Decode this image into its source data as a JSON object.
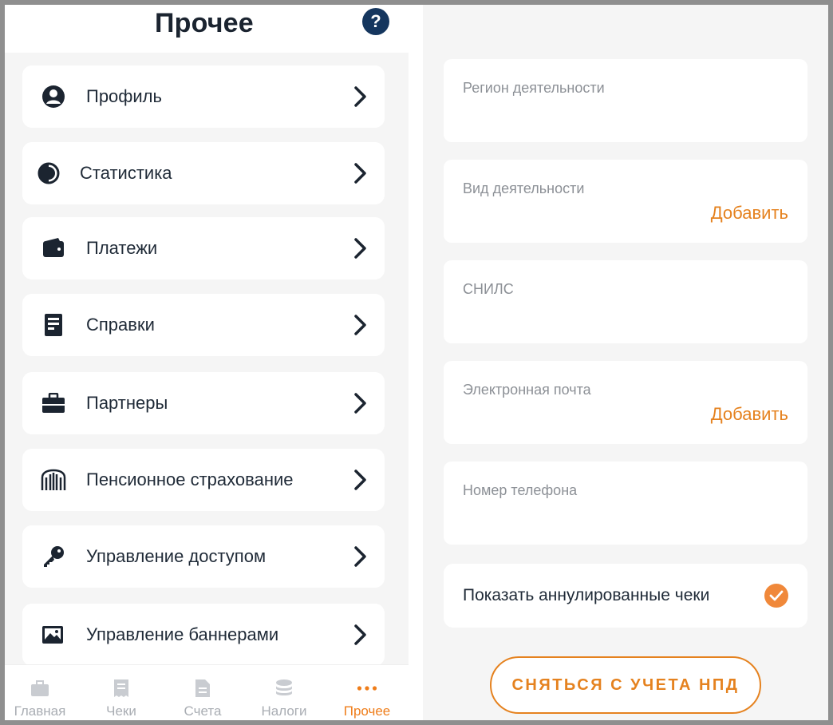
{
  "header": {
    "title": "Прочее",
    "help_label": "?"
  },
  "menu": [
    {
      "label": "Профиль",
      "icon": "user-icon"
    },
    {
      "label": "Статистика",
      "icon": "pie-chart-icon"
    },
    {
      "label": "Платежи",
      "icon": "wallet-icon"
    },
    {
      "label": "Справки",
      "icon": "document-icon"
    },
    {
      "label": "Партнеры",
      "icon": "briefcase-icon"
    },
    {
      "label": "Пенсионное страхование",
      "icon": "pension-fund-icon"
    },
    {
      "label": "Управление доступом",
      "icon": "key-icon"
    },
    {
      "label": "Управление баннерами",
      "icon": "image-icon"
    }
  ],
  "nav": [
    {
      "label": "Главная",
      "icon": "home-icon",
      "active": false
    },
    {
      "label": "Чеки",
      "icon": "receipt-icon",
      "active": false
    },
    {
      "label": "Счета",
      "icon": "invoice-icon",
      "active": false
    },
    {
      "label": "Налоги",
      "icon": "coins-icon",
      "active": false
    },
    {
      "label": "Прочее",
      "icon": "more-dots-icon",
      "active": true
    }
  ],
  "profile_fields": [
    {
      "label": "Регион деятельности",
      "action": ""
    },
    {
      "label": "Вид деятельности",
      "action": "Добавить"
    },
    {
      "label": "СНИЛС",
      "action": ""
    },
    {
      "label": "Электронная почта",
      "action": "Добавить"
    },
    {
      "label": "Номер телефона",
      "action": ""
    }
  ],
  "toggle": {
    "label": "Показать аннулированные чеки",
    "checked": true
  },
  "deregister_button": "СНЯТЬСЯ С УЧЕТА НПД",
  "colors": {
    "accent": "#e5821f",
    "dark": "#15365e",
    "background": "#f5f5f5"
  }
}
